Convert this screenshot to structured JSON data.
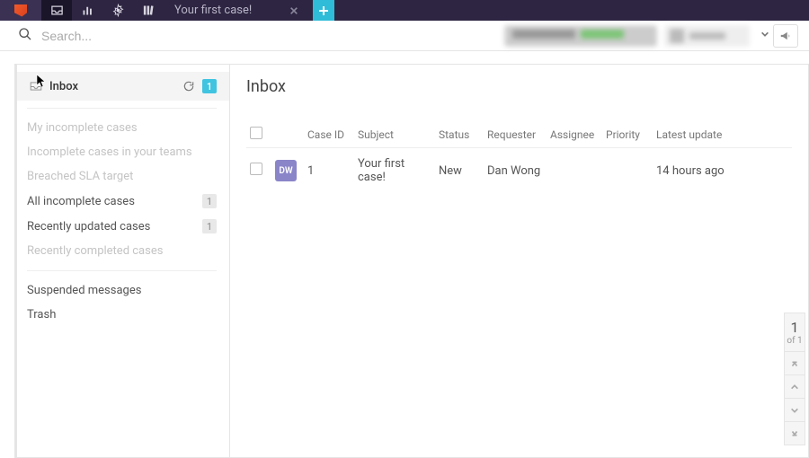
{
  "topbar": {
    "tab_title": "Your first case!"
  },
  "search": {
    "placeholder": "Search..."
  },
  "sidebar": {
    "inbox_label": "Inbox",
    "inbox_count": "1",
    "my_incomplete": "My incomplete cases",
    "team_incomplete": "Incomplete cases in your teams",
    "breached": "Breached SLA target",
    "all_incomplete": "All incomplete cases",
    "all_incomplete_count": "1",
    "recently_updated": "Recently updated cases",
    "recently_updated_count": "1",
    "recently_completed": "Recently completed cases",
    "suspended": "Suspended messages",
    "trash": "Trash"
  },
  "content": {
    "title": "Inbox",
    "columns": {
      "case_id": "Case ID",
      "subject": "Subject",
      "status": "Status",
      "requester": "Requester",
      "assignee": "Assignee",
      "priority": "Priority",
      "latest_update": "Latest update"
    },
    "rows": [
      {
        "avatar_initials": "DW",
        "case_id": "1",
        "subject": "Your first case!",
        "status": "New",
        "requester": "Dan Wong",
        "assignee": "",
        "priority": "",
        "latest_update": "14 hours ago"
      }
    ]
  },
  "pager": {
    "current": "1",
    "total_label": "of 1"
  }
}
